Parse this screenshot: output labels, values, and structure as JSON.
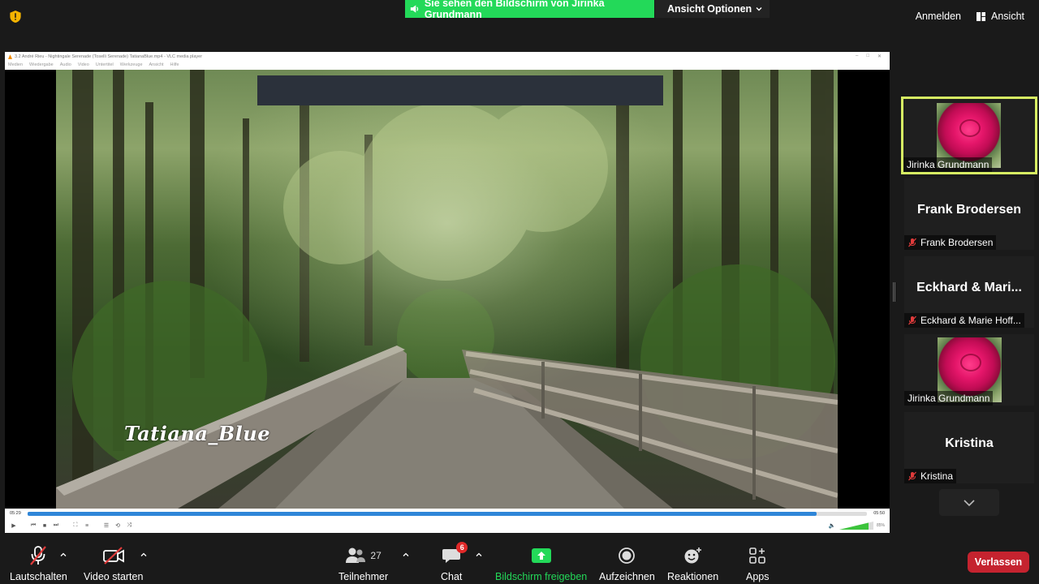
{
  "top": {
    "share_banner": "Sie sehen den Bildschirm von Jirinka Grundmann",
    "view_options": "Ansicht Optionen",
    "sign_in": "Anmelden",
    "view": "Ansicht"
  },
  "vlc": {
    "title": "3.2 André Rieu - Nightingale Serenade (Toselli Serenade) TatianaBlue.mp4 - VLC media player",
    "menu": [
      "Medien",
      "Wiedergabe",
      "Audio",
      "Video",
      "Untertitel",
      "Werkzeuge",
      "Ansicht",
      "Hilfe"
    ],
    "time_elapsed": "05:29",
    "time_total": "05:50",
    "progress": 0.94,
    "volume": 0.85,
    "volume_label": "85%",
    "watermark": "Tatiana_Blue"
  },
  "gallery": {
    "tiles": [
      {
        "big_name": "",
        "label": "Jirinka Grundmann",
        "muted": false,
        "has_photo": true
      },
      {
        "big_name": "Frank Brodersen",
        "label": "Frank Brodersen",
        "muted": true,
        "has_photo": false
      },
      {
        "big_name": "Eckhard & Mari...",
        "label": "Eckhard & Marie Hoff...",
        "muted": true,
        "has_photo": false
      },
      {
        "big_name": "",
        "label": "Jirinka Grundmann",
        "muted": false,
        "has_photo": true
      },
      {
        "big_name": "Kristina",
        "label": "Kristina",
        "muted": true,
        "has_photo": false
      }
    ]
  },
  "toolbar": {
    "mute": "Lautschalten",
    "video": "Video starten",
    "participants": "Teilnehmer",
    "participants_count": "27",
    "chat": "Chat",
    "chat_badge": "6",
    "share": "Bildschirm freigeben",
    "record": "Aufzeichnen",
    "reactions": "Reaktionen",
    "apps": "Apps",
    "leave": "Verlassen"
  },
  "colors": {
    "accent_green": "#23d959",
    "active_speaker": "#d7ef63",
    "leave_red": "#c5232f",
    "badge_red": "#e02828"
  }
}
